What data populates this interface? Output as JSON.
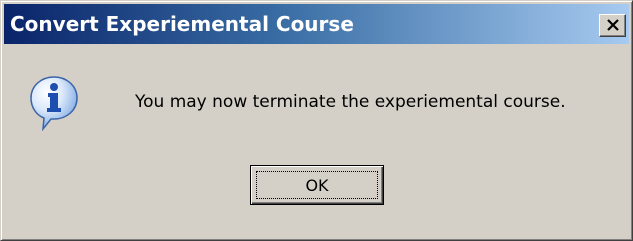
{
  "window": {
    "title": "Convert Experiemental Course",
    "close_icon": "close-x-icon"
  },
  "content": {
    "icon": "information-balloon-icon",
    "message": "You may now terminate the experiemental course."
  },
  "buttons": {
    "ok_label": "OK"
  },
  "colors": {
    "face": "#d4d0c8",
    "title_start": "#0a246a",
    "title_end": "#a6caf0"
  }
}
